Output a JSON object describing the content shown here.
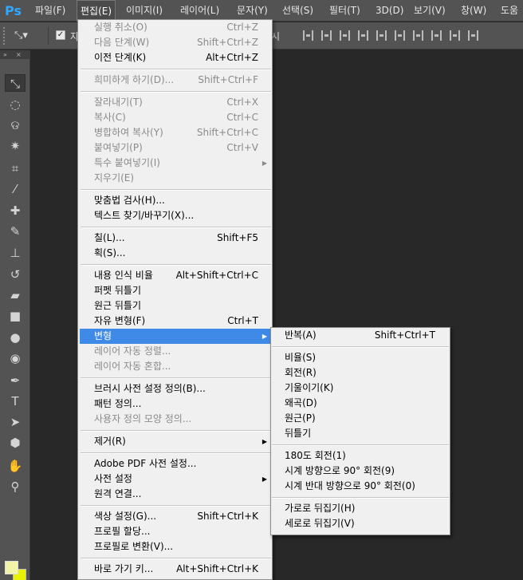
{
  "app": {
    "logo": "Ps",
    "accent": "#31a8ff",
    "menu_highlight": "#3f8ae7"
  },
  "menubar": [
    "파일(F)",
    "편집(E)",
    "이미지(I)",
    "레이어(L)",
    "문자(Y)",
    "선택(S)",
    "필터(T)",
    "3D(D)",
    "보기(V)",
    "창(W)",
    "도움"
  ],
  "options_bar": {
    "tool_icon": "move-tool-icon",
    "checkbox_label": "자",
    "show_label": "시"
  },
  "edit_menu": [
    {
      "label": "실행 취소(O)",
      "shortcut": "Ctrl+Z",
      "disabled": true
    },
    {
      "label": "다음 단계(W)",
      "shortcut": "Shift+Ctrl+Z",
      "disabled": true
    },
    {
      "label": "이전 단계(K)",
      "shortcut": "Alt+Ctrl+Z"
    },
    {
      "sep": true
    },
    {
      "label": "희미하게 하기(D)...",
      "shortcut": "Shift+Ctrl+F",
      "disabled": true
    },
    {
      "sep": true
    },
    {
      "label": "잘라내기(T)",
      "shortcut": "Ctrl+X",
      "disabled": true
    },
    {
      "label": "복사(C)",
      "shortcut": "Ctrl+C",
      "disabled": true
    },
    {
      "label": "병합하여 복사(Y)",
      "shortcut": "Shift+Ctrl+C",
      "disabled": true
    },
    {
      "label": "붙여넣기(P)",
      "shortcut": "Ctrl+V",
      "disabled": true
    },
    {
      "label": "특수 붙여넣기(I)",
      "disabled": true,
      "submenu": true
    },
    {
      "label": "지우기(E)",
      "disabled": true
    },
    {
      "sep": true
    },
    {
      "label": "맞춤법 검사(H)..."
    },
    {
      "label": "텍스트 찾기/바꾸기(X)..."
    },
    {
      "sep": true
    },
    {
      "label": "칠(L)...",
      "shortcut": "Shift+F5"
    },
    {
      "label": "획(S)..."
    },
    {
      "sep": true
    },
    {
      "label": "내용 인식 비율",
      "shortcut": "Alt+Shift+Ctrl+C"
    },
    {
      "label": "퍼펫 뒤틀기"
    },
    {
      "label": "원근 뒤틀기"
    },
    {
      "label": "자유 변형(F)",
      "shortcut": "Ctrl+T"
    },
    {
      "label": "변형",
      "submenu": true,
      "highlighted": true
    },
    {
      "label": "레이어 자동 정렬...",
      "disabled": true
    },
    {
      "label": "레이어 자동 혼합...",
      "disabled": true
    },
    {
      "sep": true
    },
    {
      "label": "브러시 사전 설정 정의(B)..."
    },
    {
      "label": "패턴 정의..."
    },
    {
      "label": "사용자 정의 모양 정의...",
      "disabled": true
    },
    {
      "sep": true
    },
    {
      "label": "제거(R)",
      "submenu": true
    },
    {
      "sep": true
    },
    {
      "label": "Adobe PDF 사전 설정..."
    },
    {
      "label": "사전 설정",
      "submenu": true
    },
    {
      "label": "원격 연결..."
    },
    {
      "sep": true
    },
    {
      "label": "색상 설정(G)...",
      "shortcut": "Shift+Ctrl+K"
    },
    {
      "label": "프로필 할당..."
    },
    {
      "label": "프로필로 변환(V)..."
    },
    {
      "sep": true
    },
    {
      "label": "바로 가기 키...",
      "shortcut": "Alt+Shift+Ctrl+K"
    }
  ],
  "transform_submenu": [
    {
      "label": "반복(A)",
      "shortcut": "Shift+Ctrl+T"
    },
    {
      "sep": true
    },
    {
      "label": "비율(S)"
    },
    {
      "label": "회전(R)"
    },
    {
      "label": "기울이기(K)"
    },
    {
      "label": "왜곡(D)"
    },
    {
      "label": "원근(P)"
    },
    {
      "label": "뒤틀기"
    },
    {
      "sep": true
    },
    {
      "label": "180도 회전(1)"
    },
    {
      "label": "시계 방향으로 90° 회전(9)"
    },
    {
      "label": "시계 반대 방향으로 90° 회전(0)"
    },
    {
      "sep": true
    },
    {
      "label": "가로로 뒤집기(H)"
    },
    {
      "label": "세로로 뒤집기(V)"
    }
  ],
  "toolbox": {
    "tools": [
      {
        "name": "move-tool-icon",
        "glyph": "⤡"
      },
      {
        "name": "marquee-tool-icon",
        "glyph": "◌"
      },
      {
        "name": "lasso-tool-icon",
        "glyph": "ଡ"
      },
      {
        "name": "magic-wand-tool-icon",
        "glyph": "✷"
      },
      {
        "name": "crop-tool-icon",
        "glyph": "⌗"
      },
      {
        "name": "eyedropper-tool-icon",
        "glyph": "⁄"
      },
      {
        "name": "healing-brush-tool-icon",
        "glyph": "✚"
      },
      {
        "name": "brush-tool-icon",
        "glyph": "✎"
      },
      {
        "name": "clone-stamp-tool-icon",
        "glyph": "⊥"
      },
      {
        "name": "history-brush-tool-icon",
        "glyph": "↺"
      },
      {
        "name": "eraser-tool-icon",
        "glyph": "▰"
      },
      {
        "name": "gradient-tool-icon",
        "glyph": "■"
      },
      {
        "name": "blur-tool-icon",
        "glyph": "●"
      },
      {
        "name": "dodge-tool-icon",
        "glyph": "◉"
      },
      {
        "name": "pen-tool-icon",
        "glyph": "✒"
      },
      {
        "name": "type-tool-icon",
        "glyph": "T"
      },
      {
        "name": "path-selection-tool-icon",
        "glyph": "➤"
      },
      {
        "name": "shape-tool-icon",
        "glyph": "⬢"
      },
      {
        "name": "hand-tool-icon",
        "glyph": "✋"
      },
      {
        "name": "zoom-tool-icon",
        "glyph": "⚲"
      }
    ],
    "foreground_color": "#f1f3a7",
    "background_color": "#e8f200"
  }
}
